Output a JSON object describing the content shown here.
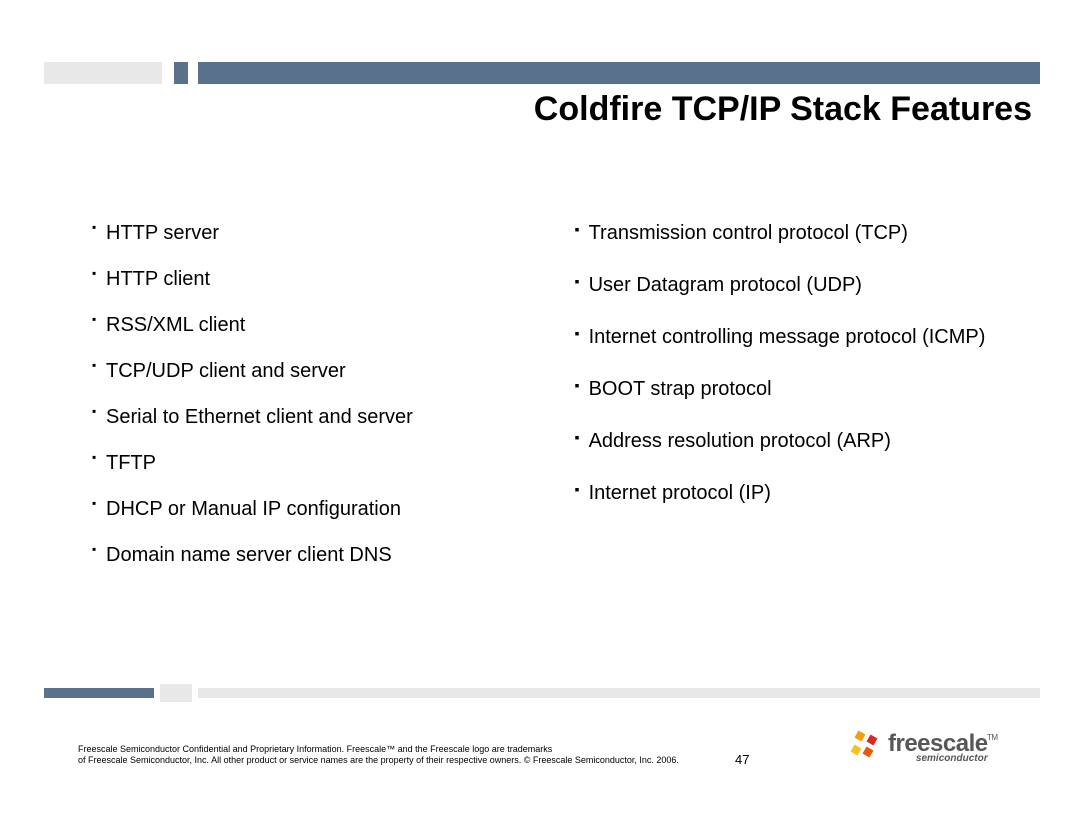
{
  "title": "Coldfire TCP/IP Stack Features",
  "left_bullets": [
    "HTTP server",
    "HTTP client",
    "RSS/XML client",
    "TCP/UDP client and server",
    "Serial to Ethernet client and server",
    "TFTP",
    "DHCP or Manual IP configuration",
    "Domain name server client DNS"
  ],
  "right_bullets": [
    "Transmission control protocol (TCP)",
    "User Datagram protocol (UDP)",
    "Internet controlling message protocol (ICMP)",
    "BOOT strap protocol",
    "Address resolution protocol (ARP)",
    "Internet protocol (IP)"
  ],
  "footer1": "Freescale Semiconductor Confidential and Proprietary Information. Freescale™ and the Freescale logo are trademarks",
  "footer2": "of Freescale Semiconductor, Inc. All other product or service names are the property of their respective owners. © Freescale Semiconductor, Inc. 2006.",
  "page_number": "47",
  "logo": {
    "main": "freescale",
    "tm": "TM",
    "sub": "semiconductor"
  }
}
